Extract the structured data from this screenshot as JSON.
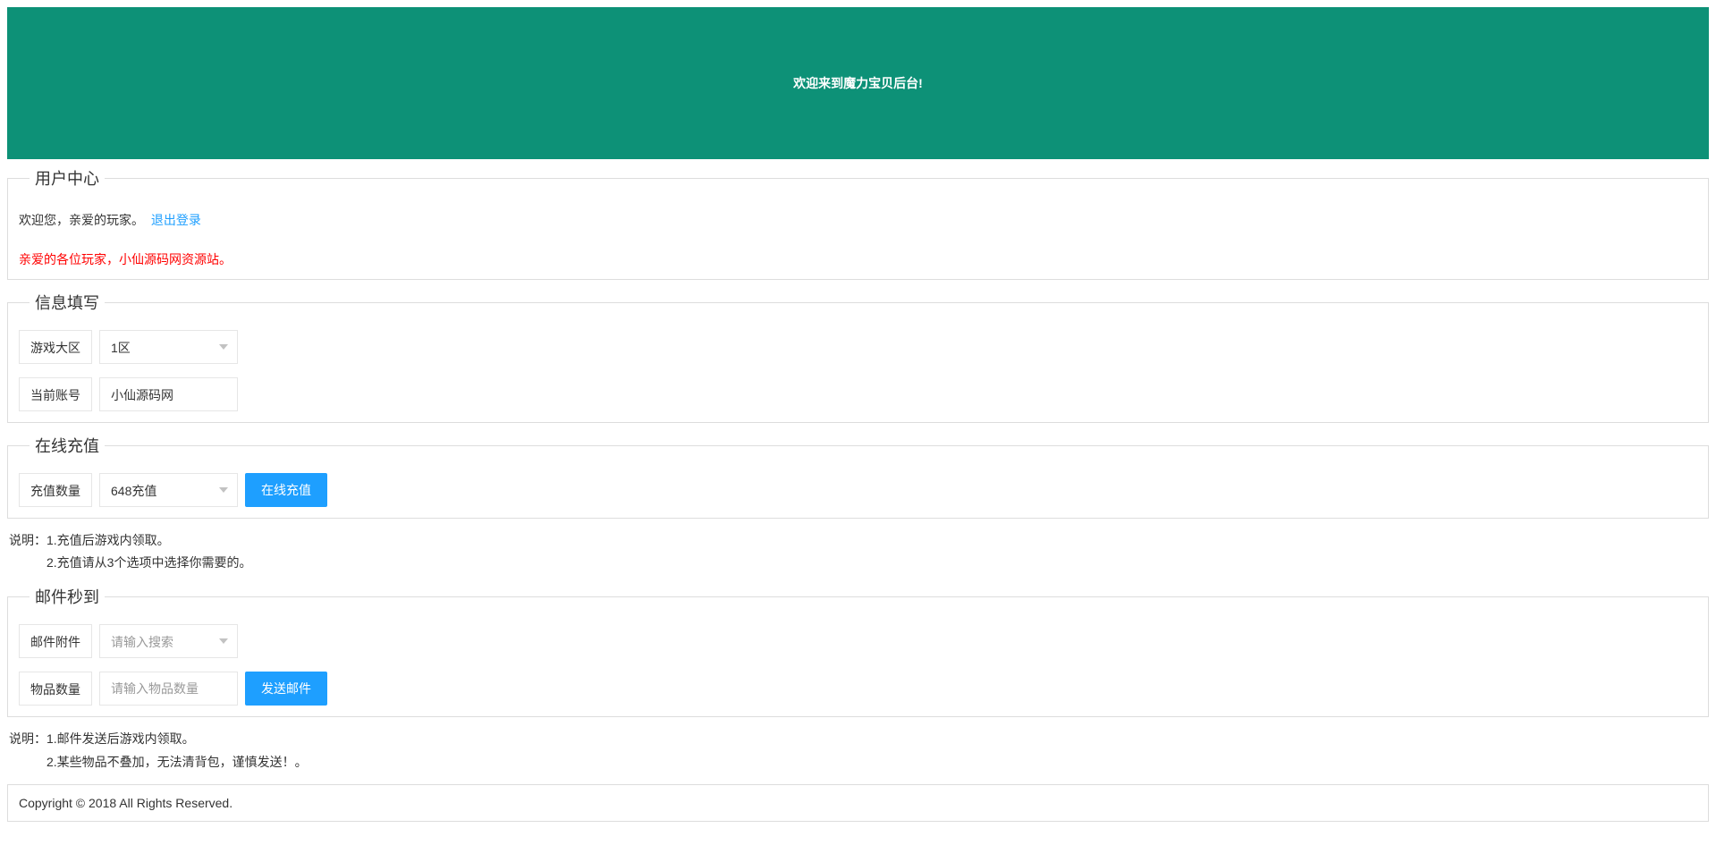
{
  "header": {
    "banner_text": "欢迎来到魔力宝贝后台!"
  },
  "user_center": {
    "title": "用户中心",
    "welcome_text": "欢迎您，亲爱的玩家。 ",
    "logout_label": "退出登录",
    "red_notice": "亲爱的各位玩家，小仙源码网资源站。"
  },
  "info_fill": {
    "title": "信息填写",
    "region_label": "游戏大区",
    "region_value": "1区",
    "account_label": "当前账号",
    "account_value": "小仙源码网"
  },
  "recharge": {
    "title": "在线充值",
    "amount_label": "充值数量",
    "amount_value": "648充值",
    "button_label": "在线充值",
    "instruction_prefix": "说明：",
    "instruction_1": "1.充值后游戏内领取。",
    "instruction_2": "2.充值请从3个选项中选择你需要的。"
  },
  "mail": {
    "title": "邮件秒到",
    "attach_label": "邮件附件",
    "attach_placeholder": "请输入搜索",
    "quantity_label": "物品数量",
    "quantity_placeholder": "请输入物品数量",
    "button_label": "发送邮件",
    "instruction_prefix": "说明：",
    "instruction_1": "1.邮件发送后游戏内领取。",
    "instruction_2": "2.某些物品不叠加，无法清背包，谨慎发送！。"
  },
  "footer": {
    "copyright": "Copyright © 2018 All Rights Reserved."
  }
}
